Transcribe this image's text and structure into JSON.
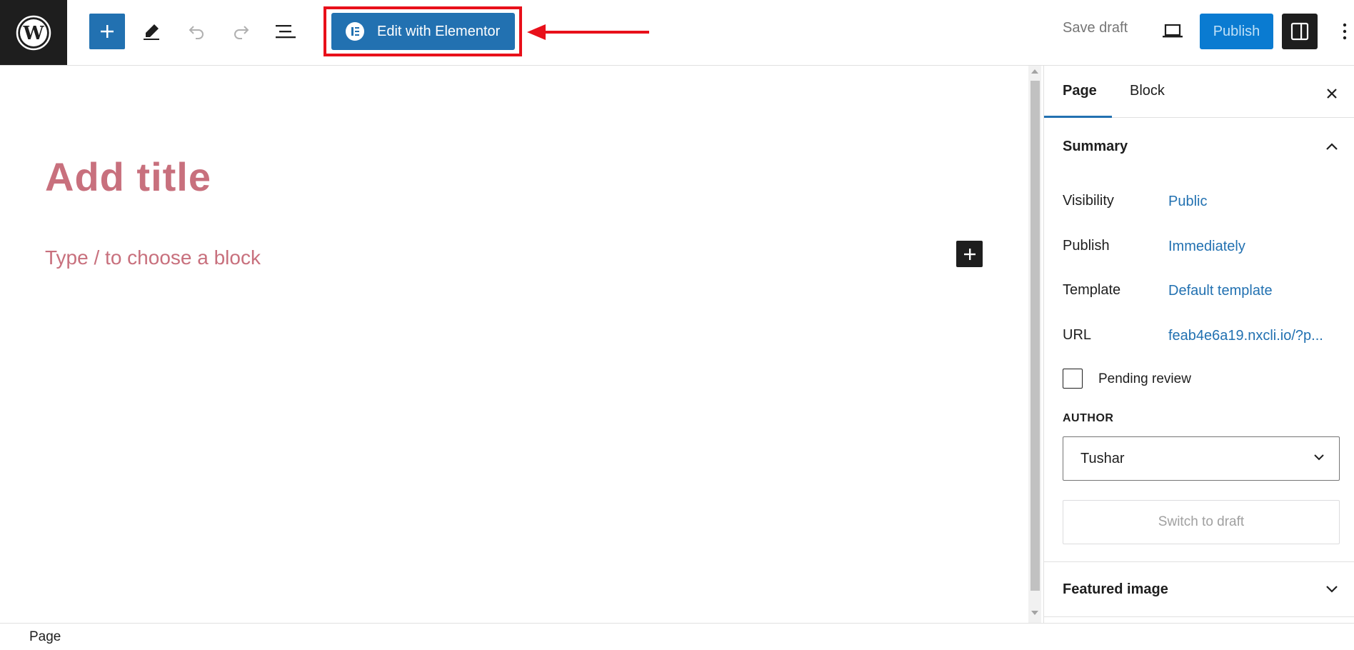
{
  "toolbar": {
    "edit_with_elementor_label": "Edit with Elementor",
    "save_draft_label": "Save draft",
    "publish_label": "Publish"
  },
  "editor": {
    "title_placeholder": "Add title",
    "block_placeholder": "Type / to choose a block"
  },
  "sidebar": {
    "tabs": [
      {
        "label": "Page",
        "active": true
      },
      {
        "label": "Block",
        "active": false
      }
    ],
    "summary": {
      "title": "Summary",
      "rows": [
        {
          "label": "Visibility",
          "value": "Public"
        },
        {
          "label": "Publish",
          "value": "Immediately"
        },
        {
          "label": "Template",
          "value": "Default template"
        },
        {
          "label": "URL",
          "value": "feab4e6a19.nxcli.io/?p..."
        }
      ],
      "pending_review_label": "Pending review",
      "pending_review_checked": false,
      "author_heading": "AUTHOR",
      "author_value": "Tushar",
      "switch_to_draft_label": "Switch to draft"
    },
    "featured_image_title": "Featured image"
  },
  "footer": {
    "breadcrumb": "Page"
  },
  "icons": {
    "logo": "wordpress-logo",
    "inserter": "plus-icon",
    "tools": "pencil-icon",
    "undo": "undo-icon",
    "redo": "redo-icon",
    "list_view": "list-view-icon",
    "elementor": "elementor-icon",
    "annotation": "red-arrow-icon",
    "preview": "laptop-icon",
    "settings": "sidebar-toggle-icon",
    "more": "more-vertical-icon"
  },
  "colors": {
    "accent": "#2271b1",
    "publish": "#0a7bd1",
    "placeholder": "#c8707d",
    "highlight": "#e8101a",
    "dark": "#1e1e1e"
  }
}
